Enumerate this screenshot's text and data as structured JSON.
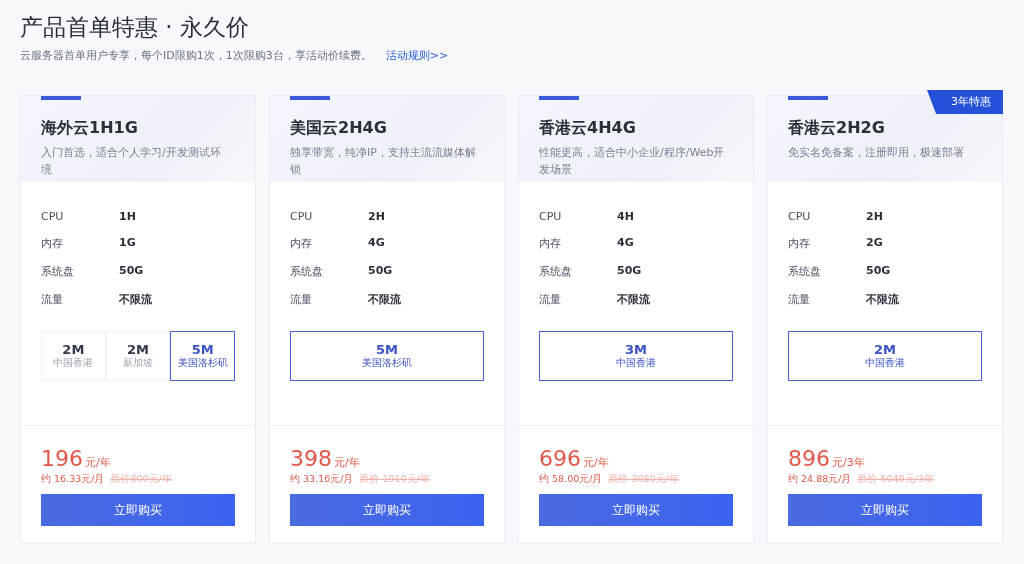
{
  "title": "产品首单特惠 · 永久价",
  "subtitle": "云服务器首单用户专享，每个ID限购1次，1次限购3台，享活动价续费。",
  "rules_link": "活动规则>>",
  "products": [
    {
      "name": "海外云1H1G",
      "desc": "入门首选，适合个人学习/开发测试环境",
      "specs": [
        {
          "label": "CPU",
          "value": "1H"
        },
        {
          "label": "内存",
          "value": "1G"
        },
        {
          "label": "系统盘",
          "value": "50G"
        },
        {
          "label": "流量",
          "value": "不限流"
        }
      ],
      "bandwidths": [
        {
          "speed": "2M",
          "region": "中国香港",
          "selected": false
        },
        {
          "speed": "2M",
          "region": "新加坡",
          "selected": false
        },
        {
          "speed": "5M",
          "region": "美国洛杉矶",
          "selected": true
        }
      ],
      "price": "196",
      "unit": "元/年",
      "monthly": "约 16.33元/月",
      "original": "原价800元/年",
      "button": "立即购买"
    },
    {
      "name": "美国云2H4G",
      "desc": "独享带宽，纯净IP，支持主流流媒体解锁",
      "specs": [
        {
          "label": "CPU",
          "value": "2H"
        },
        {
          "label": "内存",
          "value": "4G"
        },
        {
          "label": "系统盘",
          "value": "50G"
        },
        {
          "label": "流量",
          "value": "不限流"
        }
      ],
      "bandwidths": [
        {
          "speed": "5M",
          "region": "美国洛杉矶",
          "selected": true
        }
      ],
      "price": "398",
      "unit": "元/年",
      "monthly": "约 33.16元/月",
      "original": "原价 1910元/年",
      "button": "立即购买"
    },
    {
      "name": "香港云4H4G",
      "desc": "性能更高，适合中小企业/程序/Web开发场景",
      "specs": [
        {
          "label": "CPU",
          "value": "4H"
        },
        {
          "label": "内存",
          "value": "4G"
        },
        {
          "label": "系统盘",
          "value": "50G"
        },
        {
          "label": "流量",
          "value": "不限流"
        }
      ],
      "bandwidths": [
        {
          "speed": "3M",
          "region": "中国香港",
          "selected": true
        }
      ],
      "price": "696",
      "unit": "元/年",
      "monthly": "约 58.00元/月",
      "original": "原价 3080元/年",
      "button": "立即购买"
    },
    {
      "name": "香港云2H2G",
      "badge": "3年特惠",
      "desc": "免实名免备案，注册即用，极速部署",
      "specs": [
        {
          "label": "CPU",
          "value": "2H"
        },
        {
          "label": "内存",
          "value": "2G"
        },
        {
          "label": "系统盘",
          "value": "50G"
        },
        {
          "label": "流量",
          "value": "不限流"
        }
      ],
      "bandwidths": [
        {
          "speed": "2M",
          "region": "中国香港",
          "selected": true
        }
      ],
      "price": "896",
      "unit": "元/3年",
      "monthly": "约 24.88元/月",
      "original": "原价 6040元/3年",
      "button": "立即购买"
    }
  ]
}
